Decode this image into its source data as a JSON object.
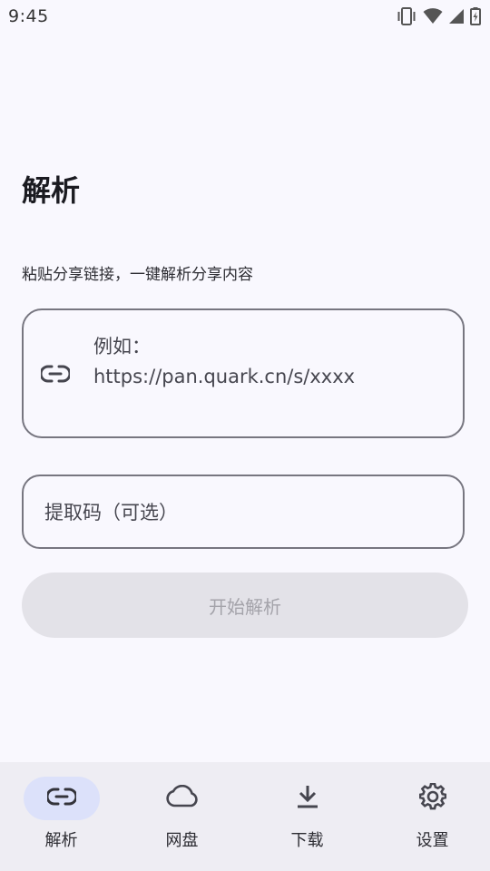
{
  "status_bar": {
    "time": "9:45",
    "icons": [
      "vibrate-icon",
      "wifi-icon",
      "cell-signal-icon",
      "battery-charging-icon"
    ]
  },
  "page": {
    "title": "解析",
    "subtitle": "粘贴分享链接，一键解析分享内容"
  },
  "link_input": {
    "icon": "link-icon",
    "placeholder": "例如：\nhttps://pan.quark.cn/s/xxxx"
  },
  "code_input": {
    "placeholder": "提取码（可选）"
  },
  "start_button": {
    "label": "开始解析",
    "enabled": false
  },
  "bottom_nav": {
    "items": [
      {
        "label": "解析",
        "icon": "link-icon",
        "active": true
      },
      {
        "label": "网盘",
        "icon": "cloud-icon",
        "active": false
      },
      {
        "label": "下载",
        "icon": "download-icon",
        "active": false
      },
      {
        "label": "设置",
        "icon": "gear-icon",
        "active": false
      }
    ]
  },
  "colors": {
    "background": "#f9f8fe",
    "outline": "#777680",
    "disabled_button": "#e3e2e8",
    "active_nav_pill": "#dce1fa",
    "nav_background": "#eeedf3"
  }
}
